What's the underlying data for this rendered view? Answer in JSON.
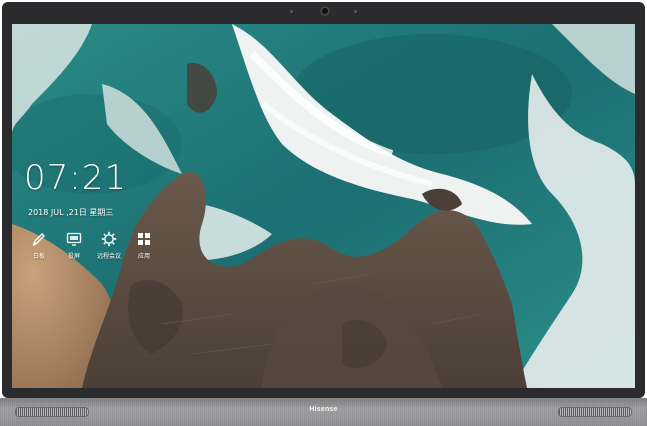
{
  "device": {
    "brand": "Hisense"
  },
  "home": {
    "time": "07:21",
    "date": "2018 JUL ,21日 星期三"
  },
  "apps": [
    {
      "label": "白板",
      "icon": "pen-icon"
    },
    {
      "label": "投屏",
      "icon": "screen-cast-icon"
    },
    {
      "label": "远程会议",
      "icon": "gear-icon"
    },
    {
      "label": "应用",
      "icon": "apps-grid-icon"
    }
  ],
  "colors": {
    "ocean": "#1f7a7a",
    "foam": "#e8efee",
    "rock": "#5a4c42",
    "sand": "#b7926c",
    "bezel": "#2b2b2d",
    "frame": "#9a9a9c"
  }
}
